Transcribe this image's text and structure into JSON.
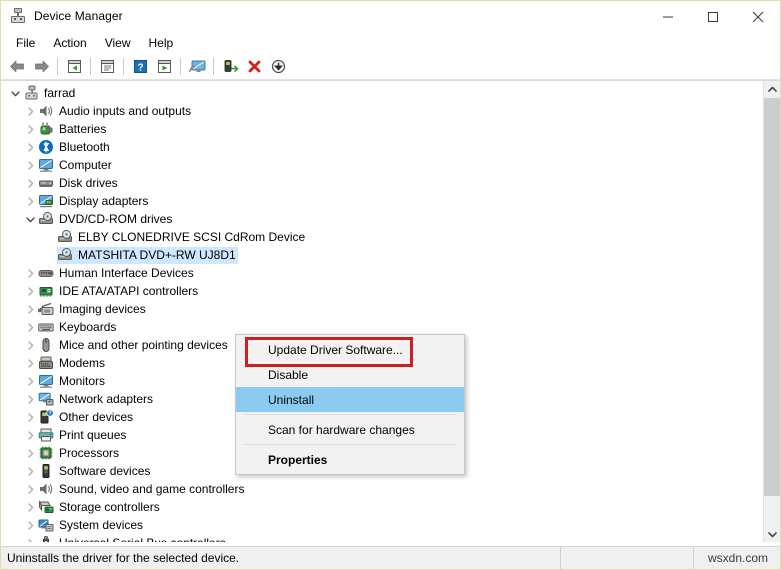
{
  "window": {
    "title": "Device Manager",
    "title_icon": "device-manager-icon",
    "controls": [
      {
        "name": "minimize-button",
        "glyph": "minimize-icon"
      },
      {
        "name": "maximize-button",
        "glyph": "maximize-icon"
      },
      {
        "name": "close-button",
        "glyph": "close-icon"
      }
    ]
  },
  "menubar": {
    "items": [
      {
        "label": "File"
      },
      {
        "label": "Action"
      },
      {
        "label": "View"
      },
      {
        "label": "Help"
      }
    ]
  },
  "toolbar": {
    "buttons": [
      {
        "name": "back-button",
        "icon": "back-arrow-icon"
      },
      {
        "name": "forward-button",
        "icon": "forward-arrow-icon"
      },
      {
        "name": "up-one-level-button",
        "icon": "up-level-icon"
      },
      {
        "name": "properties-button",
        "icon": "properties-window-icon"
      },
      {
        "name": "help-button",
        "icon": "help-question-icon"
      },
      {
        "name": "show-hidden-button",
        "icon": "play-window-icon"
      },
      {
        "name": "scan-hardware-button",
        "icon": "scan-monitor-icon"
      },
      {
        "name": "update-driver-button",
        "icon": "update-driver-icon"
      },
      {
        "name": "uninstall-button",
        "icon": "red-x-icon"
      },
      {
        "name": "disable-button",
        "icon": "down-arrow-circle-icon"
      }
    ]
  },
  "tree": {
    "nodes": [
      {
        "label": "farrad",
        "level": 0,
        "state": "expanded",
        "icon": "computer-root-icon",
        "selected": false
      },
      {
        "label": "Audio inputs and outputs",
        "level": 1,
        "state": "collapsed",
        "icon": "speaker-icon",
        "selected": false
      },
      {
        "label": "Batteries",
        "level": 1,
        "state": "collapsed",
        "icon": "battery-icon",
        "selected": false
      },
      {
        "label": "Bluetooth",
        "level": 1,
        "state": "collapsed",
        "icon": "bluetooth-icon",
        "selected": false
      },
      {
        "label": "Computer",
        "level": 1,
        "state": "collapsed",
        "icon": "monitor-icon",
        "selected": false
      },
      {
        "label": "Disk drives",
        "level": 1,
        "state": "collapsed",
        "icon": "disk-drive-icon",
        "selected": false
      },
      {
        "label": "Display adapters",
        "level": 1,
        "state": "collapsed",
        "icon": "display-adapter-icon",
        "selected": false
      },
      {
        "label": "DVD/CD-ROM drives",
        "level": 1,
        "state": "expanded",
        "icon": "optical-drive-icon",
        "selected": false
      },
      {
        "label": "ELBY CLONEDRIVE SCSI CdRom Device",
        "level": 2,
        "state": "leaf",
        "icon": "optical-drive-icon",
        "selected": false
      },
      {
        "label": "MATSHITA DVD+-RW UJ8D1",
        "level": 2,
        "state": "leaf",
        "icon": "optical-drive-icon",
        "selected": true
      },
      {
        "label": "Human Interface Devices",
        "level": 1,
        "state": "collapsed",
        "icon": "hid-icon",
        "selected": false
      },
      {
        "label": "IDE ATA/ATAPI controllers",
        "level": 1,
        "state": "collapsed",
        "icon": "ide-controller-icon",
        "selected": false
      },
      {
        "label": "Imaging devices",
        "level": 1,
        "state": "collapsed",
        "icon": "imaging-device-icon",
        "selected": false
      },
      {
        "label": "Keyboards",
        "level": 1,
        "state": "collapsed",
        "icon": "keyboard-icon",
        "selected": false
      },
      {
        "label": "Mice and other pointing devices",
        "level": 1,
        "state": "collapsed",
        "icon": "mouse-icon",
        "selected": false
      },
      {
        "label": "Modems",
        "level": 1,
        "state": "collapsed",
        "icon": "modem-icon",
        "selected": false
      },
      {
        "label": "Monitors",
        "level": 1,
        "state": "collapsed",
        "icon": "monitor-icon",
        "selected": false
      },
      {
        "label": "Network adapters",
        "level": 1,
        "state": "collapsed",
        "icon": "network-adapter-icon",
        "selected": false
      },
      {
        "label": "Other devices",
        "level": 1,
        "state": "collapsed",
        "icon": "other-device-icon",
        "selected": false
      },
      {
        "label": "Print queues",
        "level": 1,
        "state": "collapsed",
        "icon": "printer-icon",
        "selected": false
      },
      {
        "label": "Processors",
        "level": 1,
        "state": "collapsed",
        "icon": "processor-icon",
        "selected": false
      },
      {
        "label": "Software devices",
        "level": 1,
        "state": "collapsed",
        "icon": "software-device-icon",
        "selected": false
      },
      {
        "label": "Sound, video and game controllers",
        "level": 1,
        "state": "collapsed",
        "icon": "speaker-icon",
        "selected": false
      },
      {
        "label": "Storage controllers",
        "level": 1,
        "state": "collapsed",
        "icon": "storage-controller-icon",
        "selected": false
      },
      {
        "label": "System devices",
        "level": 1,
        "state": "collapsed",
        "icon": "system-device-icon",
        "selected": false
      },
      {
        "label": "Universal Serial Bus controllers",
        "level": 1,
        "state": "collapsed",
        "icon": "usb-icon",
        "selected": false
      }
    ]
  },
  "context_menu": {
    "items": [
      {
        "label": "Update Driver Software...",
        "highlight": false,
        "bold": false
      },
      {
        "label": "Disable",
        "highlight": false,
        "bold": false
      },
      {
        "label": "Uninstall",
        "highlight": true,
        "bold": false
      },
      {
        "label": "Scan for hardware changes",
        "highlight": false,
        "bold": false
      },
      {
        "label": "Properties",
        "highlight": false,
        "bold": true
      }
    ]
  },
  "annotation": {
    "highlight_color": "#cc1f1f",
    "target_label": "Update Driver Software..."
  },
  "statusbar": {
    "message": "Uninstalls the driver for the selected device.",
    "watermark": "wsxdn.com"
  },
  "colors": {
    "selection_blue": "#cde8ff",
    "menu_highlight": "#8ccbf0",
    "window_border": "#e8d9a8"
  },
  "scrollbar": {
    "up_arrow": "scroll-up-icon",
    "down_arrow": "scroll-down-icon"
  }
}
